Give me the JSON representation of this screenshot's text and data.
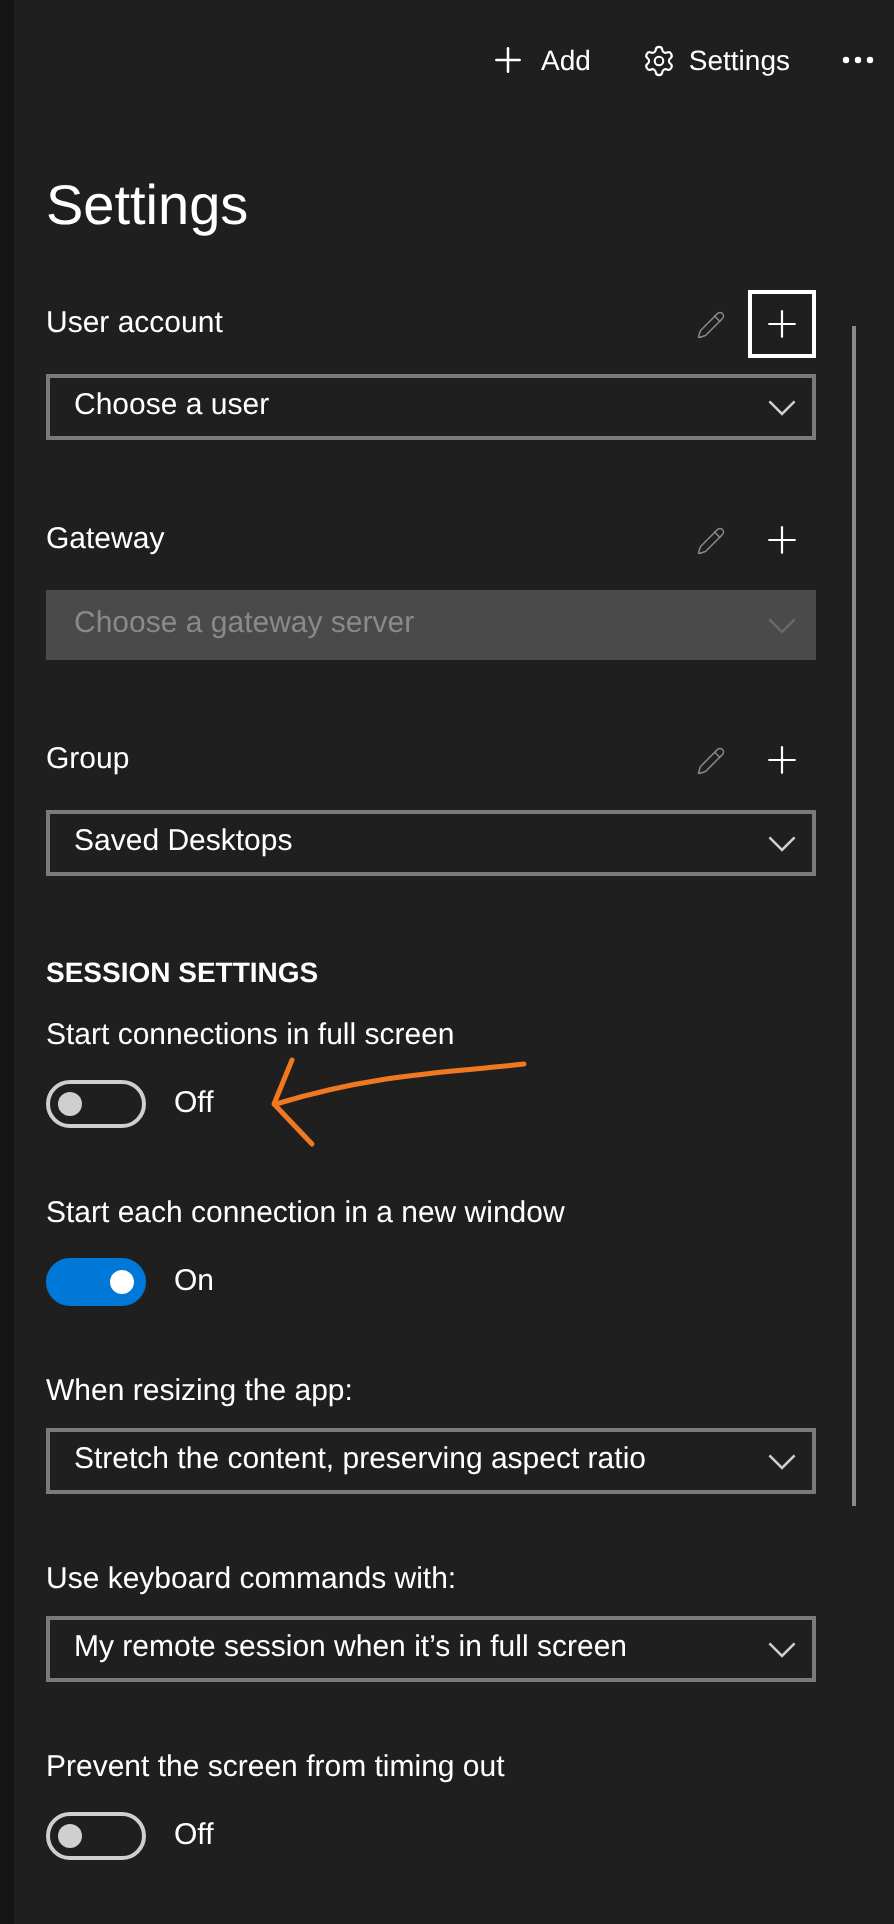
{
  "toolbar": [
    {
      "kind": "add",
      "label": "Add"
    },
    {
      "kind": "settings",
      "label": "Settings"
    },
    {
      "kind": "more"
    }
  ],
  "title": "Settings",
  "sections": [
    {
      "label": "User account",
      "value": "Choose a user",
      "disabled": false,
      "add_focused": true
    },
    {
      "label": "Gateway",
      "value": "Choose a gateway server",
      "disabled": true,
      "add_focused": false
    },
    {
      "label": "Group",
      "value": "Saved Desktops",
      "disabled": false,
      "add_focused": false
    }
  ],
  "session_heading": "SESSION SETTINGS",
  "settings": [
    {
      "kind": "toggle",
      "label": "Start connections in full screen",
      "on": false,
      "state_label": "Off"
    },
    {
      "kind": "toggle",
      "label": "Start each connection in a new window",
      "on": true,
      "state_label": "On"
    },
    {
      "kind": "dropdown",
      "label": "When resizing the app:",
      "value": "Stretch the content, preserving aspect ratio"
    },
    {
      "kind": "dropdown",
      "label": "Use keyboard commands with:",
      "value": "My remote session when it’s in full screen"
    },
    {
      "kind": "toggle",
      "label": "Prevent the screen from timing out",
      "on": false,
      "state_label": "Off"
    }
  ]
}
